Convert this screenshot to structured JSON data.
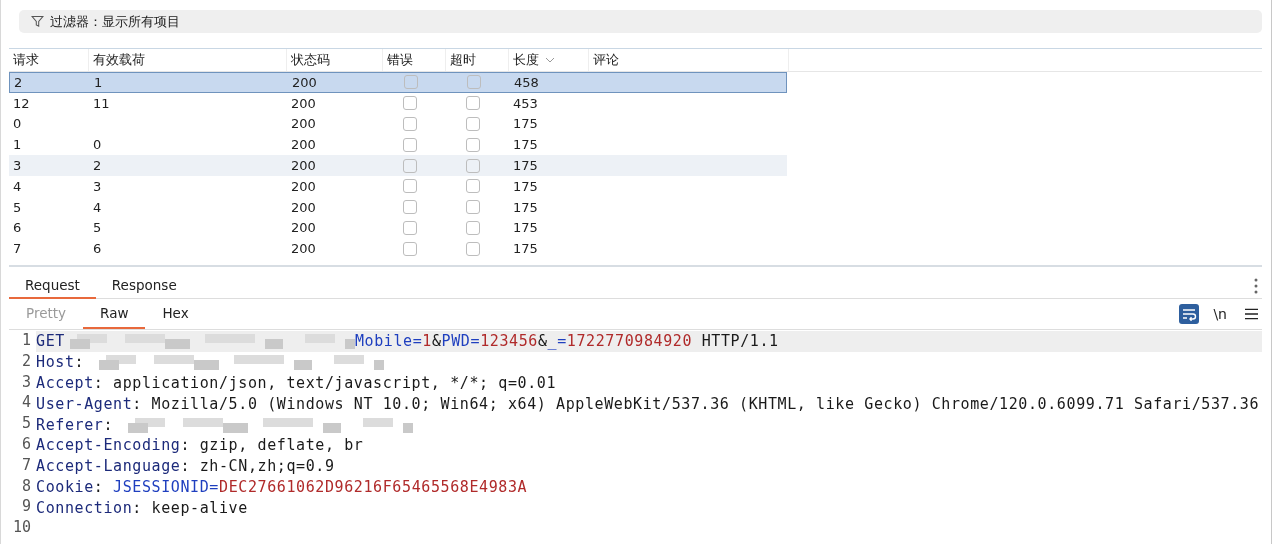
{
  "filter": {
    "label": "过滤器：显示所有项目"
  },
  "table": {
    "columns": [
      {
        "label": "请求",
        "sorted": false
      },
      {
        "label": "有效载荷",
        "sorted": false
      },
      {
        "label": "状态码",
        "sorted": false
      },
      {
        "label": "错误",
        "sorted": false
      },
      {
        "label": "超时",
        "sorted": false
      },
      {
        "label": "长度",
        "sorted": true
      },
      {
        "label": "评论",
        "sorted": false
      }
    ],
    "rows": [
      {
        "request": "2",
        "payload": "1",
        "status": "200",
        "error": false,
        "timeout": false,
        "length": "458",
        "selected": true,
        "hovered": false
      },
      {
        "request": "12",
        "payload": "11",
        "status": "200",
        "error": false,
        "timeout": false,
        "length": "453",
        "selected": false,
        "hovered": false
      },
      {
        "request": "0",
        "payload": "",
        "status": "200",
        "error": false,
        "timeout": false,
        "length": "175",
        "selected": false,
        "hovered": false
      },
      {
        "request": "1",
        "payload": "0",
        "status": "200",
        "error": false,
        "timeout": false,
        "length": "175",
        "selected": false,
        "hovered": false
      },
      {
        "request": "3",
        "payload": "2",
        "status": "200",
        "error": false,
        "timeout": false,
        "length": "175",
        "selected": false,
        "hovered": true
      },
      {
        "request": "4",
        "payload": "3",
        "status": "200",
        "error": false,
        "timeout": false,
        "length": "175",
        "selected": false,
        "hovered": false
      },
      {
        "request": "5",
        "payload": "4",
        "status": "200",
        "error": false,
        "timeout": false,
        "length": "175",
        "selected": false,
        "hovered": false
      },
      {
        "request": "6",
        "payload": "5",
        "status": "200",
        "error": false,
        "timeout": false,
        "length": "175",
        "selected": false,
        "hovered": false
      },
      {
        "request": "7",
        "payload": "6",
        "status": "200",
        "error": false,
        "timeout": false,
        "length": "175",
        "selected": false,
        "hovered": false
      }
    ]
  },
  "tabs": [
    {
      "label": "Request",
      "selected": true
    },
    {
      "label": "Response",
      "selected": false
    }
  ],
  "view_tabs": [
    {
      "label": "Pretty",
      "selected": false,
      "disabled": true
    },
    {
      "label": "Raw",
      "selected": true,
      "disabled": false
    },
    {
      "label": "Hex",
      "selected": false,
      "disabled": false
    }
  ],
  "toolbar": {
    "wrap_on": true,
    "newline_label": "\\n"
  },
  "editor": {
    "lines": [
      {
        "number": "1",
        "current": true,
        "segments": [
          {
            "kind": "method",
            "text": "GET"
          },
          {
            "kind": "redacted"
          },
          {
            "kind": "param",
            "text": "Mobile="
          },
          {
            "kind": "value",
            "text": "1"
          },
          {
            "kind": "plain",
            "text": "&"
          },
          {
            "kind": "param",
            "text": "PWD="
          },
          {
            "kind": "value",
            "text": "123456"
          },
          {
            "kind": "plain",
            "text": "&"
          },
          {
            "kind": "param",
            "text": "_="
          },
          {
            "kind": "value",
            "text": "1722770984920"
          },
          {
            "kind": "plain",
            "text": " HTTP/1.1"
          }
        ]
      },
      {
        "number": "2",
        "current": false,
        "segments": [
          {
            "kind": "header",
            "text": "Host"
          },
          {
            "kind": "plain",
            "text": ": "
          },
          {
            "kind": "redacted"
          }
        ]
      },
      {
        "number": "3",
        "current": false,
        "segments": [
          {
            "kind": "header",
            "text": "Accept"
          },
          {
            "kind": "plain",
            "text": ": application/json, text/javascript, */*; q=0.01"
          }
        ]
      },
      {
        "number": "4",
        "current": false,
        "segments": [
          {
            "kind": "header",
            "text": "User-Agent"
          },
          {
            "kind": "plain",
            "text": ": Mozilla/5.0 (Windows NT 10.0; Win64; x64) AppleWebKit/537.36 (KHTML, like Gecko) Chrome/120.0.6099.71 Safari/537.36"
          }
        ]
      },
      {
        "number": "5",
        "current": false,
        "segments": [
          {
            "kind": "header",
            "text": "Referer"
          },
          {
            "kind": "plain",
            "text": ": "
          },
          {
            "kind": "redacted"
          }
        ]
      },
      {
        "number": "6",
        "current": false,
        "segments": [
          {
            "kind": "header",
            "text": "Accept-Encoding"
          },
          {
            "kind": "plain",
            "text": ": gzip, deflate, br"
          }
        ]
      },
      {
        "number": "7",
        "current": false,
        "segments": [
          {
            "kind": "header",
            "text": "Accept-Language"
          },
          {
            "kind": "plain",
            "text": ": zh-CN,zh;q=0.9"
          }
        ]
      },
      {
        "number": "8",
        "current": false,
        "segments": [
          {
            "kind": "header",
            "text": "Cookie"
          },
          {
            "kind": "plain",
            "text": ": "
          },
          {
            "kind": "param",
            "text": "JSESSIONID="
          },
          {
            "kind": "value",
            "text": "DEC27661062D96216F65465568E4983A"
          }
        ]
      },
      {
        "number": "9",
        "current": false,
        "segments": [
          {
            "kind": "header",
            "text": "Connection"
          },
          {
            "kind": "plain",
            "text": ": keep-alive"
          }
        ]
      },
      {
        "number": "10",
        "current": false
      }
    ]
  }
}
